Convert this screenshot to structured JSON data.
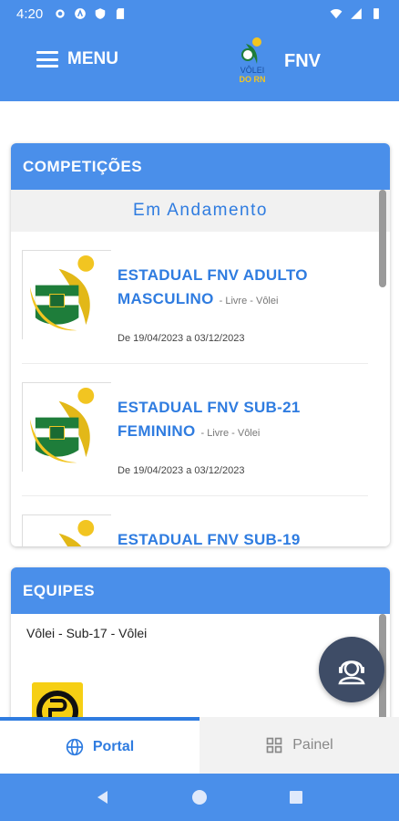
{
  "status": {
    "time": "4:20"
  },
  "header": {
    "menu_label": "MENU",
    "brand": "FNV",
    "logo_text_1": "VÔLEI",
    "logo_text_2": "DO RN"
  },
  "competitions": {
    "title": "COMPETIÇÕES",
    "subtitle": "Em Andamento",
    "items": [
      {
        "title_line1": "ESTADUAL FNV ADULTO",
        "title_line2": "MASCULINO",
        "tag": "- Livre - Vôlei",
        "dates": "De 19/04/2023 a 03/12/2023"
      },
      {
        "title_line1": "ESTADUAL FNV SUB-21",
        "title_line2": "FEMININO",
        "tag": "- Livre - Vôlei",
        "dates": "De 19/04/2023 a 03/12/2023"
      },
      {
        "title_line1": "ESTADUAL FNV SUB-19",
        "title_line2": "",
        "tag": "",
        "dates": ""
      }
    ]
  },
  "teams": {
    "title": "EQUIPES",
    "first_item": "Vôlei - Sub-17 - Vôlei"
  },
  "bottom_nav": {
    "portal": "Portal",
    "painel": "Painel"
  },
  "colors": {
    "primary": "#4a8fea",
    "accent_text": "#2f7ce0",
    "fab": "#3e4c66"
  },
  "icons": [
    "settings-icon",
    "a-icon",
    "shield-icon",
    "sd-card-icon",
    "wifi-icon",
    "signal-icon",
    "battery-icon",
    "globe-icon",
    "grid-icon",
    "support-agent-icon"
  ]
}
